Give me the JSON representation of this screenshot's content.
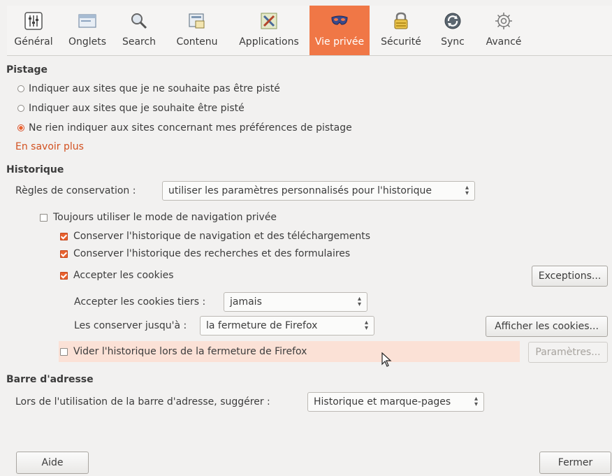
{
  "tabs": [
    {
      "label": "Général",
      "icon": "general-icon"
    },
    {
      "label": "Onglets",
      "icon": "tabs-icon"
    },
    {
      "label": "Search",
      "icon": "search-icon"
    },
    {
      "label": "Contenu",
      "icon": "content-icon"
    },
    {
      "label": "Applications",
      "icon": "applications-icon"
    },
    {
      "label": "Vie privée",
      "icon": "privacy-mask-icon"
    },
    {
      "label": "Sécurité",
      "icon": "security-lock-icon"
    },
    {
      "label": "Sync",
      "icon": "sync-icon"
    },
    {
      "label": "Avancé",
      "icon": "advanced-gear-icon"
    }
  ],
  "active_tab": "Vie privée",
  "tracking": {
    "title": "Pistage",
    "opt1": "Indiquer aux sites que je ne souhaite pas être pisté",
    "opt2": "Indiquer aux sites que je souhaite être pisté",
    "opt3": "Ne rien indiquer aux sites concernant mes préférences de pistage",
    "selected": 3,
    "learn_more": "En savoir plus"
  },
  "history": {
    "title": "Historique",
    "rules_label": "Règles de conservation :",
    "rules_value": "utiliser les paramètres personnalisés pour l'historique",
    "private_mode": "Toujours utiliser le mode de navigation privée",
    "private_mode_checked": false,
    "keep_browsing": "Conserver l'historique de navigation et des téléchargements",
    "keep_browsing_checked": true,
    "keep_search": "Conserver l'historique des recherches et des formulaires",
    "keep_search_checked": true,
    "accept_cookies": "Accepter les cookies",
    "accept_cookies_checked": true,
    "exceptions_btn": "Exceptions...",
    "third_party_label": "Accepter les cookies tiers :",
    "third_party_value": "jamais",
    "keep_until_label": "Les conserver jusqu'à :",
    "keep_until_value": "la fermeture de Firefox",
    "show_cookies_btn": "Afficher les cookies...",
    "clear_on_close": "Vider l'historique lors de la fermeture de Firefox",
    "clear_on_close_checked": false,
    "settings_btn": "Paramètres..."
  },
  "address_bar": {
    "title": "Barre d'adresse",
    "suggest_label": "Lors de l'utilisation de la barre d'adresse, suggérer :",
    "suggest_value": "Historique et marque-pages"
  },
  "footer": {
    "help_btn": "Aide",
    "close_btn": "Fermer"
  },
  "colors": {
    "accent": "#f07746",
    "link": "#d25120",
    "highlight_row": "#fbe1d6"
  }
}
